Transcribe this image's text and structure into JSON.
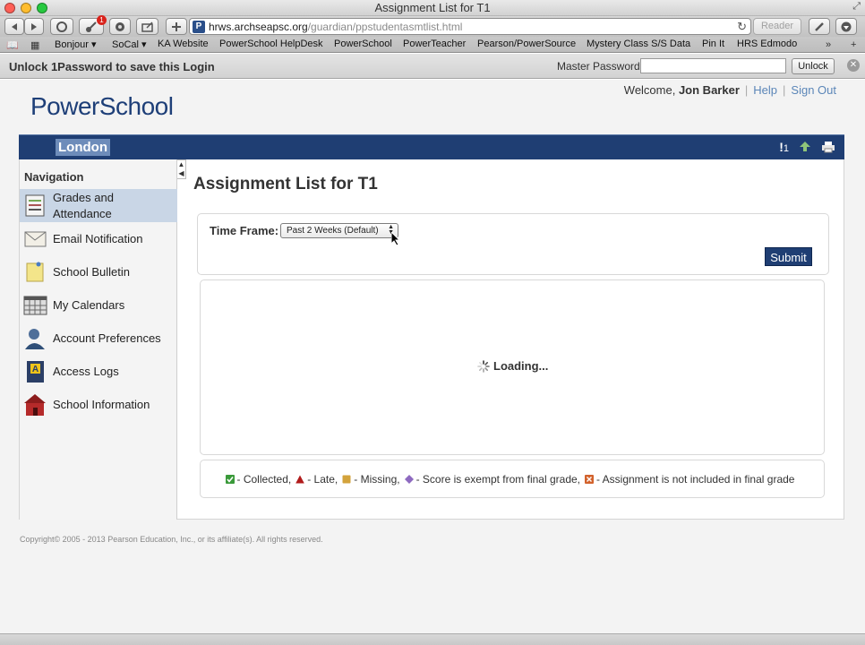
{
  "window": {
    "title": "Assignment List for T1"
  },
  "toolbar": {
    "url_host": "hrws.archseapsc.org",
    "url_path": "/guardian/ppstudentasmtlist.html",
    "reader_label": "Reader",
    "notification_count": "1"
  },
  "bookmarks": [
    "Bonjour ▾",
    "SoCal ▾",
    "KA Website",
    "PowerSchool HelpDesk",
    "PowerSchool",
    "PowerTeacher",
    "Pearson/PowerSource",
    "Mystery Class S/S Data",
    "Pin It",
    "HRS Edmodo"
  ],
  "onepassword": {
    "message": "Unlock 1Password to save this Login",
    "master_label": "Master Password",
    "unlock_label": "Unlock"
  },
  "header": {
    "logo": "PowerSchool",
    "welcome_prefix": "Welcome, ",
    "user_name": "Jon Barker",
    "help": "Help",
    "sign_out": "Sign Out",
    "school": "London",
    "alert_count": "1"
  },
  "nav": {
    "heading": "Navigation",
    "items": [
      {
        "label": "Grades and Attendance",
        "icon": "grades-icon",
        "active": true
      },
      {
        "label": "Email Notification",
        "icon": "envelope-icon"
      },
      {
        "label": "School Bulletin",
        "icon": "bulletin-icon"
      },
      {
        "label": "My Calendars",
        "icon": "calendar-icon"
      },
      {
        "label": "Account Preferences",
        "icon": "user-icon"
      },
      {
        "label": "Access Logs",
        "icon": "log-book-icon"
      },
      {
        "label": "School Information",
        "icon": "school-house-icon"
      }
    ]
  },
  "main": {
    "title": "Assignment List for T1",
    "time_frame_label": "Time Frame:",
    "time_frame_value": "Past 2 Weeks (Default)",
    "submit_label": "Submit",
    "loading_text": "Loading..."
  },
  "legend": {
    "collected": "- Collected,",
    "late": "- Late,",
    "missing": "- Missing,",
    "exempt": "- Score is exempt from final grade,",
    "not_included": "- Assignment is not included in final grade"
  },
  "footer": {
    "copyright": "Copyright© 2005 - 2013 Pearson Education, Inc., or its affiliate(s). All rights reserved."
  },
  "colors": {
    "brand_blue": "#1f3e73",
    "nav_active": "#c9d6e6",
    "link": "#5b86b8"
  }
}
